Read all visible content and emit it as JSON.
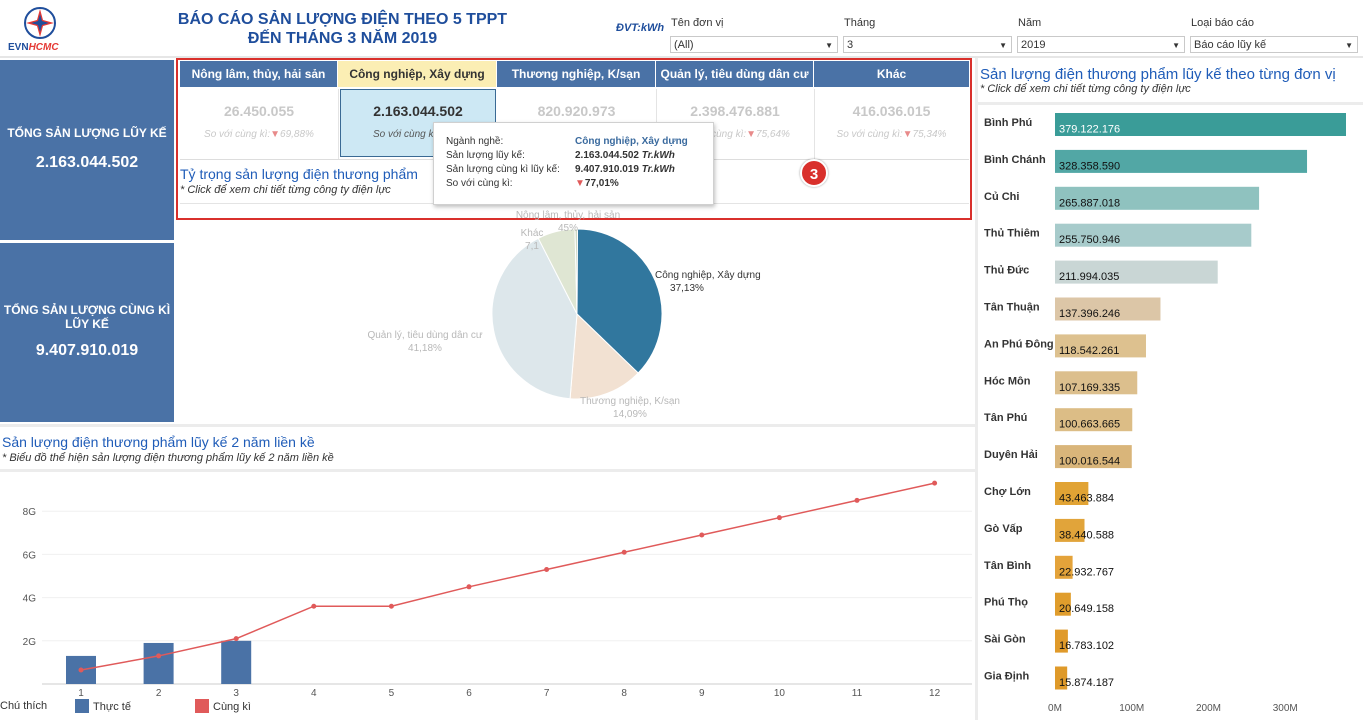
{
  "header": {
    "logo_main": "EVN",
    "logo_accent": "HCMC",
    "title_line1": "BÁO CÁO SẢN LƯỢNG ĐIỆN THEO 5 TPPT",
    "title_line2": "ĐẾN THÁNG 3 NĂM 2019",
    "unit": "ĐVT:kWh"
  },
  "filters": [
    {
      "label": "Tên đơn vị",
      "value": "(All)"
    },
    {
      "label": "Tháng",
      "value": "3"
    },
    {
      "label": "Năm",
      "value": "2019"
    },
    {
      "label": "Loại báo cáo",
      "value": "Báo cáo lũy kế"
    }
  ],
  "kpis": {
    "cumulative_label": "TỔNG SẢN LƯỢNG LŨY KẾ",
    "cumulative_value": "2.163.044.502",
    "same_period_label_line1": "TỔNG SẢN LƯỢNG CÙNG KÌ",
    "same_period_label_line2": "LŨY KẾ",
    "same_period_value": "9.407.910.019"
  },
  "categories": [
    {
      "name": "Nông lâm, thủy, hải sản",
      "value": "26.450.055",
      "compare": "So với cùng kì:",
      "pct": "69,88%"
    },
    {
      "name": "Công nghiệp, Xây dựng",
      "value": "2.163.044.502",
      "compare": "So với cùng kì:",
      "pct": "77,01%"
    },
    {
      "name": "Thương nghiệp, K/sạn",
      "value": "820.920.973",
      "compare": "So với cùng kì:",
      "pct": "77,01%"
    },
    {
      "name": "Quản lý, tiêu dùng dân cư",
      "value": "2.398.476.881",
      "compare": "So với cùng kì:",
      "pct": "75,64%"
    },
    {
      "name": "Khác",
      "value": "416.036.015",
      "compare": "So với cùng kì:",
      "pct": "75,34%"
    }
  ],
  "badge": "3",
  "tooltip": {
    "r1_label": "Ngành nghề:",
    "r1_value": "Công nghiệp, Xây dựng",
    "r2_label": "Sản lượng lũy kế:",
    "r2_value": "2.163.044.502",
    "r2_unit": "Tr.kWh",
    "r3_label": "Sản lượng cùng kì lũy kế:",
    "r3_value": "9.407.910.019",
    "r3_unit": "Tr.kWh",
    "r4_label": "So với cùng kì:",
    "r4_value": "77,01%"
  },
  "pie_section": {
    "title": "Tỷ trọng sản lượng điện thương phẩm",
    "subtitle": "* Click để xem chi tiết từng công ty điện lực"
  },
  "line_section": {
    "title": "Sản lượng điện thương phẩm lũy kế 2 năm liền kề",
    "subtitle": "* Biểu đồ thể hiện sản lượng điện thương phẩm lũy kế 2 năm liền kề"
  },
  "bar_section": {
    "title": "Sản lượng điện thương phẩm lũy kế theo từng đơn vị",
    "subtitle": "* Click để xem chi tiết từng công ty điện lực"
  },
  "legend": {
    "label": "Chú thích",
    "actual": "Thực tế",
    "same_period": "Cùng kì"
  },
  "colors": {
    "brand_blue": "#4a72a6",
    "title_blue": "#1f5cb8",
    "highlight": "#fbeeb4",
    "line_red": "#e05a5a",
    "badge_red": "#d9302c"
  },
  "chart_data": [
    {
      "type": "pie",
      "title": "Tỷ trọng sản lượng điện thương phẩm",
      "categories": [
        "Công nghiệp, Xây dựng",
        "Thương nghiệp, K/sạn",
        "Quản lý, tiêu dùng dân cư",
        "Khác",
        "Nông lâm, thủy, hải sản"
      ],
      "values": [
        37.13,
        14.09,
        41.18,
        7.15,
        0.45
      ],
      "labels": [
        "37,13%",
        "14,09%",
        "41,18%",
        "7,1",
        "45%"
      ],
      "colors": [
        "#31779e",
        "#f2e1d2",
        "#dde7eb",
        "#dfe6d3",
        "#c8d4bd"
      ]
    },
    {
      "type": "bar",
      "title": "Sản lượng điện thương phẩm lũy kế theo từng đơn vị",
      "orientation": "horizontal",
      "categories": [
        "Bình Phú",
        "Bình Chánh",
        "Củ Chi",
        "Thủ Thiêm",
        "Thủ Đức",
        "Tân Thuận",
        "An Phú Đông",
        "Hóc Môn",
        "Tân Phú",
        "Duyên Hải",
        "Chợ Lớn",
        "Gò Vấp",
        "Tân Bình",
        "Phú Thọ",
        "Sài Gòn",
        "Gia Định"
      ],
      "values": [
        379122176,
        328358590,
        265887018,
        255750946,
        211994035,
        137396246,
        118542261,
        107169335,
        100663665,
        100016544,
        43463884,
        38440588,
        22932767,
        20649158,
        16783102,
        15874187
      ],
      "value_labels": [
        "379.122.176",
        "328.358.590",
        "265.887.018",
        "255.750.946",
        "211.994.035",
        "137.396.246",
        "118.542.261",
        "107.169.335",
        "100.663.665",
        "100.016.544",
        "43.463.884",
        "38.440.588",
        "22.932.767",
        "20.649.158",
        "16.783.102",
        "15.874.187"
      ],
      "colors": [
        "#3a9c98",
        "#52a7a5",
        "#8fc2bf",
        "#a7cbcb",
        "#c9d6d5",
        "#dcc6a7",
        "#ddc18f",
        "#dcbf8d",
        "#dcbd86",
        "#d9b57a",
        "#e1a334",
        "#e1a43a",
        "#e4a33a",
        "#e09d2c",
        "#e09a2a",
        "#df9a2a"
      ],
      "xticks": [
        "0M",
        "100M",
        "200M",
        "300M"
      ],
      "xlim": [
        0,
        400000000
      ]
    },
    {
      "type": "bar+line",
      "title": "Sản lượng điện thương phẩm lũy kế 2 năm liền kề",
      "categories": [
        "1",
        "2",
        "3",
        "4",
        "5",
        "6",
        "7",
        "8",
        "9",
        "10",
        "11",
        "12"
      ],
      "yticks": [
        "2G",
        "4G",
        "6G",
        "8G"
      ],
      "ylim": [
        0,
        10
      ],
      "series": [
        {
          "name": "Thực tế",
          "type": "bar",
          "values": [
            1.3,
            1.9,
            2.0,
            null,
            null,
            null,
            null,
            null,
            null,
            null,
            null,
            null
          ]
        },
        {
          "name": "Cùng kì",
          "type": "line",
          "values": [
            0.65,
            1.3,
            2.1,
            3.6,
            3.6,
            4.5,
            5.3,
            6.1,
            6.9,
            7.7,
            8.5,
            9.3
          ]
        }
      ]
    }
  ]
}
